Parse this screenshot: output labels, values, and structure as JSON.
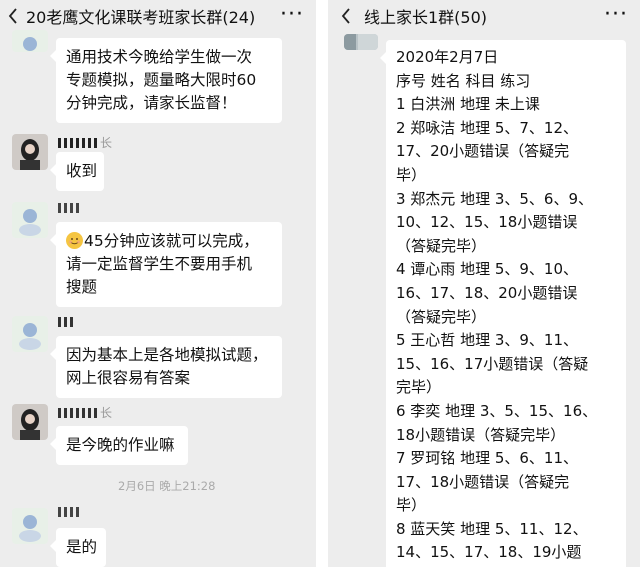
{
  "left_chat": {
    "title": "20老鹰文化课联考班家长群(24)",
    "messages": [
      {
        "sender": "",
        "lines": [
          "通用技术今晚给学生做一次",
          "专题模拟，题量略大限时60",
          "分钟完成，请家长监督！"
        ]
      },
      {
        "sender": "长",
        "lines": [
          "收到"
        ]
      },
      {
        "sender": "",
        "lines": [
          "45分钟应该就可以完成，",
          "请一定监督学生不要用手机",
          "搜题"
        ],
        "emoji": "smiling-face-icon"
      },
      {
        "sender": "",
        "lines": [
          "因为基本上是各地模拟试题，",
          "网上很容易有答案"
        ]
      },
      {
        "sender": "长",
        "lines": [
          "是今晚的作业嘛"
        ]
      },
      {
        "sender": "",
        "lines": [
          "是的"
        ]
      }
    ],
    "timestamp": "2月6日 晚上21:28"
  },
  "right_chat": {
    "title": "线上家长1群(50)",
    "message": {
      "lines": [
        "2020年2月7日",
        "序号 姓名 科目 练习",
        "1 白洪洲 地理 未上课",
        "2 郑咏洁 地理 5、7、12、",
        "17、20小题错误（答疑完",
        "毕）",
        "3 郑杰元 地理 3、5、6、9、",
        "10、12、15、18小题错误",
        "（答疑完毕）",
        "4 谭心雨 地理 5、9、10、",
        "16、17、18、20小题错误",
        "（答疑完毕）",
        "5 王心哲 地理 3、9、11、",
        "15、16、17小题错误（答疑",
        "完毕）",
        "6 李奕 地理 3、5、15、16、",
        "18小题错误（答疑完毕）",
        "7 罗珂铭 地理 5、6、11、",
        "17、18小题错误（答疑完",
        "毕）",
        "8 蓝天笑 地理 5、11、12、",
        "14、15、17、18、19小题"
      ]
    }
  },
  "colors": {
    "background": "#ededed",
    "bubble": "#ffffff",
    "meta_text": "#999999"
  }
}
